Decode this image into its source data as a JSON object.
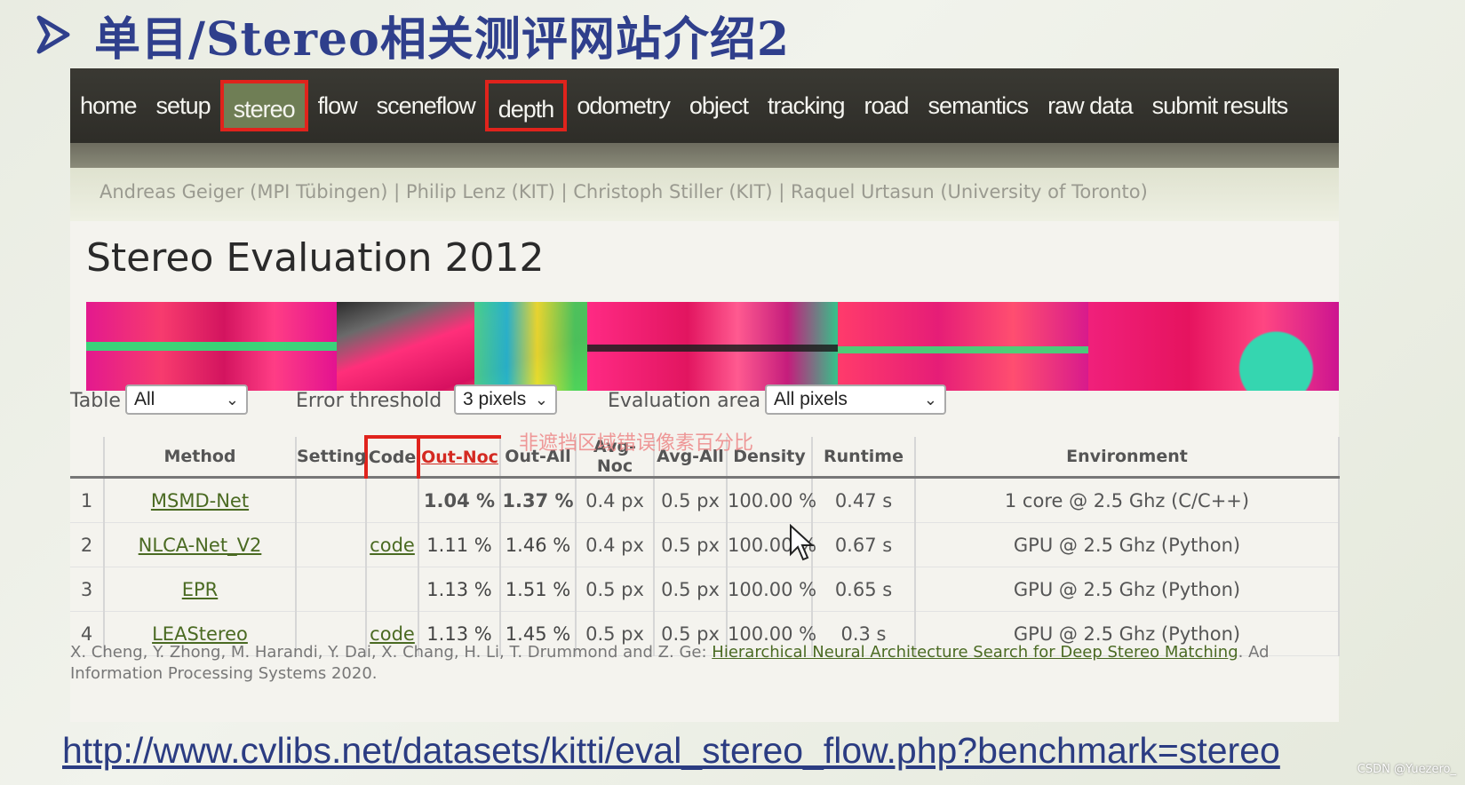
{
  "slide": {
    "title": "单目/Stereo相关测评网站介绍2",
    "url": "http://www.cvlibs.net/datasets/kitti/eval_stereo_flow.php?benchmark=stereo",
    "watermark": "CSDN @Yuezero_",
    "annotation": "非遮挡区域错误像素百分比"
  },
  "nav": {
    "items": [
      {
        "label": "home"
      },
      {
        "label": "setup"
      },
      {
        "label": "stereo",
        "active": true,
        "highlighted": true
      },
      {
        "label": "flow"
      },
      {
        "label": "sceneflow"
      },
      {
        "label": "depth",
        "highlighted": true
      },
      {
        "label": "odometry"
      },
      {
        "label": "object"
      },
      {
        "label": "tracking"
      },
      {
        "label": "road"
      },
      {
        "label": "semantics"
      },
      {
        "label": "raw data"
      },
      {
        "label": "submit results"
      }
    ]
  },
  "authors": "Andreas Geiger (MPI Tübingen) | Philip Lenz (KIT) | Christoph Stiller (KIT) | Raquel Urtasun (University of Toronto)",
  "page_heading": "Stereo Evaluation 2012",
  "filters": {
    "table_label": "Table",
    "table_value": "All",
    "threshold_label": "Error threshold",
    "threshold_value": "3 pixels",
    "area_label": "Evaluation area",
    "area_value": "All pixels"
  },
  "table": {
    "headers": [
      "",
      "Method",
      "Setting",
      "Code",
      "Out-Noc",
      "Out-All",
      "Avg-Noc",
      "Avg-All",
      "Density",
      "Runtime",
      "Environment"
    ],
    "rows": [
      {
        "rank": "1",
        "method": "MSMD-Net",
        "setting": "",
        "code": "",
        "out_noc": "1.04 %",
        "out_all": "1.37 %",
        "avg_noc": "0.4 px",
        "avg_all": "0.5 px",
        "density": "100.00 %",
        "runtime": "0.47 s",
        "environment": "1 core @ 2.5 Ghz (C/C++)"
      },
      {
        "rank": "2",
        "method": "NLCA-Net_V2",
        "setting": "",
        "code": "code",
        "out_noc": "1.11 %",
        "out_all": "1.46 %",
        "avg_noc": "0.4 px",
        "avg_all": "0.5 px",
        "density": "100.00 %",
        "runtime": "0.67 s",
        "environment": "GPU @ 2.5 Ghz (Python)"
      },
      {
        "rank": "3",
        "method": "EPR",
        "setting": "",
        "code": "",
        "out_noc": "1.13 %",
        "out_all": "1.51 %",
        "avg_noc": "0.5 px",
        "avg_all": "0.5 px",
        "density": "100.00 %",
        "runtime": "0.65 s",
        "environment": "GPU @ 2.5 Ghz (Python)"
      },
      {
        "rank": "4",
        "method": "LEAStereo",
        "setting": "",
        "code": "code",
        "out_noc": "1.13 %",
        "out_all": "1.45 %",
        "avg_noc": "0.5 px",
        "avg_all": "0.5 px",
        "density": "100.00 %",
        "runtime": "0.3 s",
        "environment": "GPU @ 2.5 Ghz (Python)"
      }
    ]
  },
  "citation": {
    "authors": "X. Cheng, Y. Zhong, M. Harandi, Y. Dai, X. Chang, H. Li, T. Drummond and Z. Ge: ",
    "paper": "Hierarchical Neural Architecture Search for Deep Stereo Matching",
    "venue": ". Ad Information Processing Systems 2020."
  },
  "colors": {
    "title": "#2f3f8c",
    "highlight_box": "#e0231c",
    "nav_bg": "#34332d",
    "nav_active": "#6f7e55",
    "link": "#4a6a22"
  }
}
